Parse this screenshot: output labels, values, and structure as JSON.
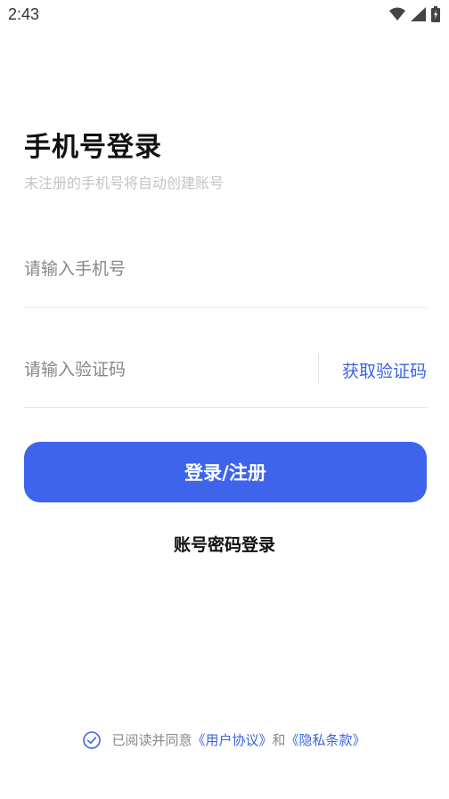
{
  "status_bar": {
    "time": "2:43",
    "icons": [
      "wifi-icon",
      "cellular-signal-icon",
      "battery-icon"
    ]
  },
  "header": {
    "title": "手机号登录",
    "subtitle": "未注册的手机号将自动创建账号"
  },
  "form": {
    "phone_placeholder": "请输入手机号",
    "phone_value": "",
    "code_placeholder": "请输入验证码",
    "code_value": "",
    "get_code_label": "获取验证码"
  },
  "actions": {
    "login_label": "登录/注册",
    "password_login_label": "账号密码登录"
  },
  "agreement": {
    "prefix": "已阅读并同意",
    "user_agreement": "《用户协议》",
    "conjunction": "和",
    "privacy_policy": "《隐私条款》",
    "checked": true
  },
  "colors": {
    "accent": "#3d64ea",
    "link": "#3a63e6",
    "title": "#111111",
    "subtitle": "#c4c4c4",
    "divider": "#e6e6e6"
  }
}
